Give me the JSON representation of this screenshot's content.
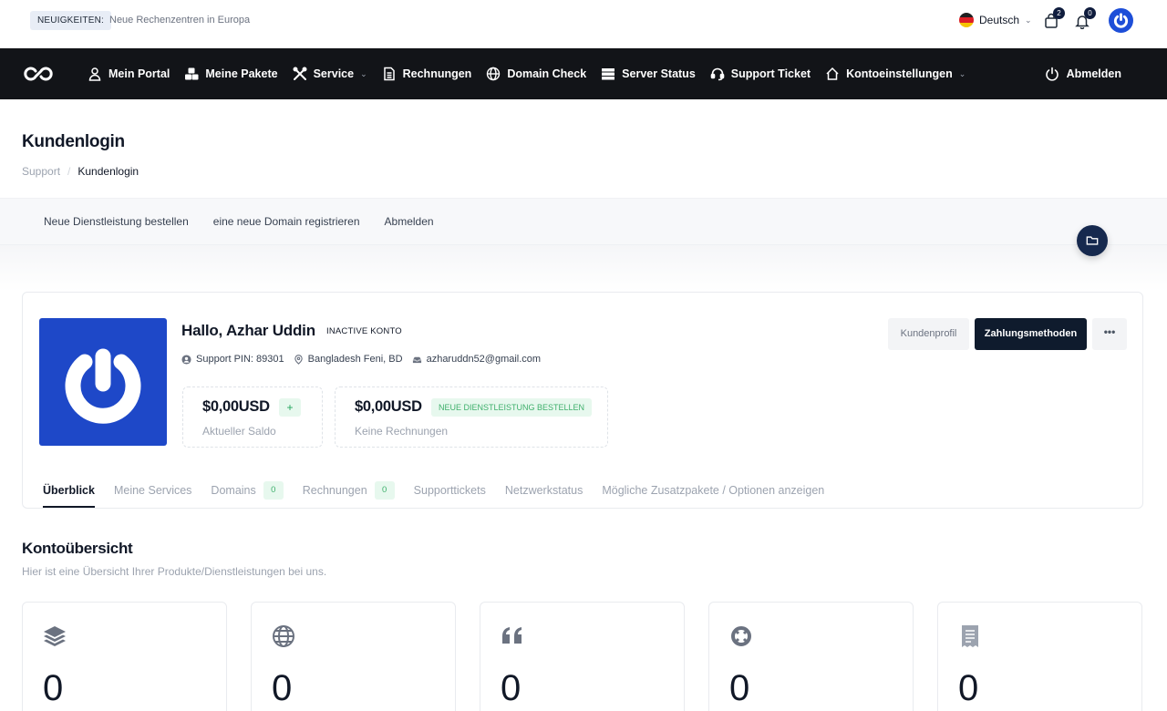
{
  "newsbar": {
    "badge": "NEUIGKEITEN:",
    "text": "Neue Rechenzentren in Europa"
  },
  "topbar": {
    "language": "Deutsch",
    "cart_count": "2",
    "notification_count": "0"
  },
  "nav": {
    "items": [
      {
        "label": "Mein Portal",
        "icon": "user-icon"
      },
      {
        "label": "Meine Pakete",
        "icon": "boxes-icon"
      },
      {
        "label": "Service",
        "icon": "tools-icon",
        "dropdown": true
      },
      {
        "label": "Rechnungen",
        "icon": "document-icon"
      },
      {
        "label": "Domain Check",
        "icon": "globe-icon"
      },
      {
        "label": "Server Status",
        "icon": "server-icon"
      },
      {
        "label": "Support Ticket",
        "icon": "headset-icon"
      },
      {
        "label": "Kontoeinstellungen",
        "icon": "home-icon",
        "dropdown": true
      }
    ],
    "logout": "Abmelden"
  },
  "page": {
    "title": "Kundenlogin",
    "breadcrumb_parent": "Support",
    "breadcrumb_current": "Kundenlogin"
  },
  "subnav": {
    "items": [
      "Neue Dienstleistung bestellen",
      "eine neue Domain registrieren",
      "Abmelden"
    ]
  },
  "profile": {
    "greeting": "Hallo, Azhar Uddin",
    "status": "INACTIVE KONTO",
    "support_pin": "Support PIN: 89301",
    "location": "Bangladesh Feni, BD",
    "email": "azharuddn52@gmail.com",
    "balance_amount": "$0,00USD",
    "balance_label": "Aktueller Saldo",
    "balance_add": "+",
    "invoice_amount": "$0,00USD",
    "invoice_tag": "NEUE DIENSTLEISTUNG BESTELLEN",
    "invoice_label": "Keine Rechnungen",
    "btn_profile": "Kundenprofil",
    "btn_payment": "Zahlungsmethoden",
    "btn_more": "•••"
  },
  "tabs": [
    {
      "label": "Überblick",
      "active": true
    },
    {
      "label": "Meine Services"
    },
    {
      "label": "Domains",
      "count": "0"
    },
    {
      "label": "Rechnungen",
      "count": "0"
    },
    {
      "label": "Supporttickets"
    },
    {
      "label": "Netzwerkstatus"
    },
    {
      "label": "Mögliche Zusatzpakete / Optionen anzeigen"
    }
  ],
  "overview": {
    "title": "Kontoübersicht",
    "subtitle": "Hier ist eine Übersicht Ihrer Produkte/Dienstleistungen bei uns.",
    "cards": [
      {
        "icon": "layers-icon",
        "value": "0"
      },
      {
        "icon": "globe-icon",
        "value": "0"
      },
      {
        "icon": "quote-icon",
        "value": "0"
      },
      {
        "icon": "lifebuoy-icon",
        "value": "0"
      },
      {
        "icon": "receipt-icon",
        "value": "0"
      }
    ]
  },
  "colors": {
    "nav_bg": "#121418",
    "brand_blue": "#1e48c8",
    "accent_dark": "#0f1b2d",
    "success_bg": "#e7f8ee",
    "success_text": "#3fb06c"
  }
}
